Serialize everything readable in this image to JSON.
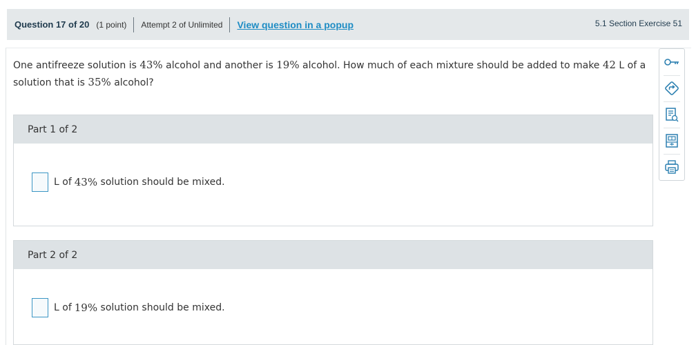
{
  "header": {
    "question_label": "Question 17 of 20",
    "points": "(1 point)",
    "attempt": "Attempt 2 of Unlimited",
    "popup_link": "View question in a popup",
    "section": "5.1 Section Exercise 51"
  },
  "question": {
    "t1": "One antifreeze solution is ",
    "v1": "43%",
    "t2": " alcohol and another is ",
    "v2": "19%",
    "t3": " alcohol. How much of each mixture should be added to make ",
    "v3": "42",
    "t4": " L of a solution that is ",
    "v4": "35%",
    "t5": " alcohol?"
  },
  "parts": [
    {
      "label": "Part 1 of 2",
      "answer_value": "",
      "pre": "L of ",
      "pct": "43%",
      "post": " solution should be mixed."
    },
    {
      "label": "Part 2 of 2",
      "answer_value": "",
      "pre": "L of ",
      "pct": "19%",
      "post": " solution should be mixed."
    }
  ],
  "toolbar": {
    "icons": [
      "key-icon",
      "hint-arrow-icon",
      "notes-icon",
      "calculator-icon",
      "print-icon"
    ],
    "accent": "#2b7fb0"
  }
}
